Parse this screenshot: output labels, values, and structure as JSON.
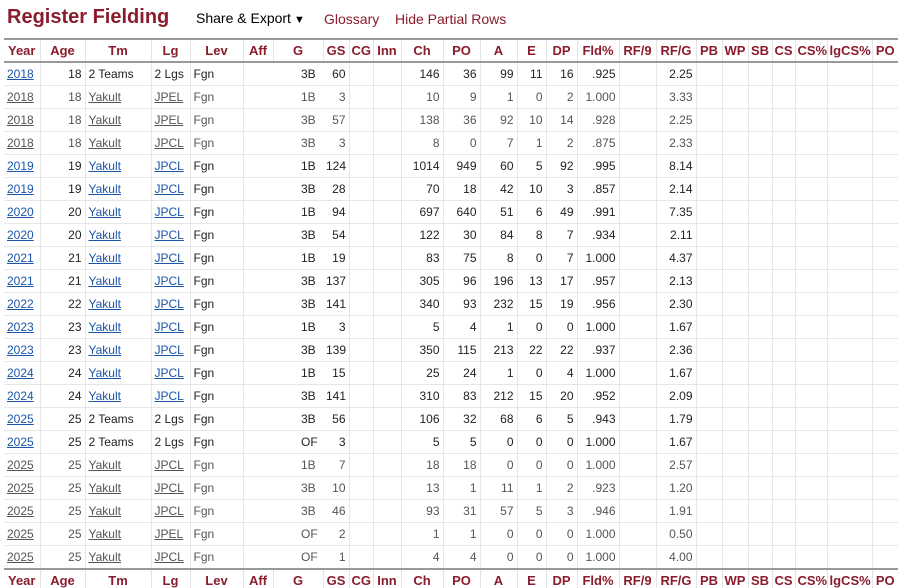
{
  "header": {
    "title": "Register Fielding",
    "share_label": "Share & Export",
    "share_caret": "▼",
    "glossary_label": "Glossary",
    "hide_partial_label": "Hide Partial Rows"
  },
  "table": {
    "columns": [
      "Year",
      "Age",
      "Tm",
      "Lg",
      "Lev",
      "Aff",
      "G",
      "GS",
      "CG",
      "Inn",
      "Ch",
      "PO",
      "A",
      "E",
      "DP",
      "Fld%",
      "RF/9",
      "RF/G",
      "PB",
      "WP",
      "SB",
      "CS",
      "CS%",
      "lgCS%",
      "PO"
    ],
    "rows": [
      {
        "partial": false,
        "cells": [
          "2018",
          "18",
          "2 Teams",
          "2 Lgs",
          "Fgn",
          "",
          "3B",
          "60",
          "",
          "",
          "146",
          "36",
          "99",
          "11",
          "16",
          ".925",
          "",
          "2.25",
          "",
          "",
          "",
          "",
          "",
          "",
          ""
        ]
      },
      {
        "partial": true,
        "cells": [
          "2018",
          "18",
          "Yakult",
          "JPEL",
          "Fgn",
          "",
          "1B",
          "3",
          "",
          "",
          "10",
          "9",
          "1",
          "0",
          "2",
          "1.000",
          "",
          "3.33",
          "",
          "",
          "",
          "",
          "",
          "",
          ""
        ]
      },
      {
        "partial": true,
        "cells": [
          "2018",
          "18",
          "Yakult",
          "JPEL",
          "Fgn",
          "",
          "3B",
          "57",
          "",
          "",
          "138",
          "36",
          "92",
          "10",
          "14",
          ".928",
          "",
          "2.25",
          "",
          "",
          "",
          "",
          "",
          "",
          ""
        ]
      },
      {
        "partial": true,
        "cells": [
          "2018",
          "18",
          "Yakult",
          "JPCL",
          "Fgn",
          "",
          "3B",
          "3",
          "",
          "",
          "8",
          "0",
          "7",
          "1",
          "2",
          ".875",
          "",
          "2.33",
          "",
          "",
          "",
          "",
          "",
          "",
          ""
        ]
      },
      {
        "partial": false,
        "cells": [
          "2019",
          "19",
          "Yakult",
          "JPCL",
          "Fgn",
          "",
          "1B",
          "124",
          "",
          "",
          "1014",
          "949",
          "60",
          "5",
          "92",
          ".995",
          "",
          "8.14",
          "",
          "",
          "",
          "",
          "",
          "",
          ""
        ]
      },
      {
        "partial": false,
        "cells": [
          "2019",
          "19",
          "Yakult",
          "JPCL",
          "Fgn",
          "",
          "3B",
          "28",
          "",
          "",
          "70",
          "18",
          "42",
          "10",
          "3",
          ".857",
          "",
          "2.14",
          "",
          "",
          "",
          "",
          "",
          "",
          ""
        ]
      },
      {
        "partial": false,
        "cells": [
          "2020",
          "20",
          "Yakult",
          "JPCL",
          "Fgn",
          "",
          "1B",
          "94",
          "",
          "",
          "697",
          "640",
          "51",
          "6",
          "49",
          ".991",
          "",
          "7.35",
          "",
          "",
          "",
          "",
          "",
          "",
          ""
        ]
      },
      {
        "partial": false,
        "cells": [
          "2020",
          "20",
          "Yakult",
          "JPCL",
          "Fgn",
          "",
          "3B",
          "54",
          "",
          "",
          "122",
          "30",
          "84",
          "8",
          "7",
          ".934",
          "",
          "2.11",
          "",
          "",
          "",
          "",
          "",
          "",
          ""
        ]
      },
      {
        "partial": false,
        "cells": [
          "2021",
          "21",
          "Yakult",
          "JPCL",
          "Fgn",
          "",
          "1B",
          "19",
          "",
          "",
          "83",
          "75",
          "8",
          "0",
          "7",
          "1.000",
          "",
          "4.37",
          "",
          "",
          "",
          "",
          "",
          "",
          ""
        ]
      },
      {
        "partial": false,
        "cells": [
          "2021",
          "21",
          "Yakult",
          "JPCL",
          "Fgn",
          "",
          "3B",
          "137",
          "",
          "",
          "305",
          "96",
          "196",
          "13",
          "17",
          ".957",
          "",
          "2.13",
          "",
          "",
          "",
          "",
          "",
          "",
          ""
        ]
      },
      {
        "partial": false,
        "cells": [
          "2022",
          "22",
          "Yakult",
          "JPCL",
          "Fgn",
          "",
          "3B",
          "141",
          "",
          "",
          "340",
          "93",
          "232",
          "15",
          "19",
          ".956",
          "",
          "2.30",
          "",
          "",
          "",
          "",
          "",
          "",
          ""
        ]
      },
      {
        "partial": false,
        "cells": [
          "2023",
          "23",
          "Yakult",
          "JPCL",
          "Fgn",
          "",
          "1B",
          "3",
          "",
          "",
          "5",
          "4",
          "1",
          "0",
          "0",
          "1.000",
          "",
          "1.67",
          "",
          "",
          "",
          "",
          "",
          "",
          ""
        ]
      },
      {
        "partial": false,
        "cells": [
          "2023",
          "23",
          "Yakult",
          "JPCL",
          "Fgn",
          "",
          "3B",
          "139",
          "",
          "",
          "350",
          "115",
          "213",
          "22",
          "22",
          ".937",
          "",
          "2.36",
          "",
          "",
          "",
          "",
          "",
          "",
          ""
        ]
      },
      {
        "partial": false,
        "cells": [
          "2024",
          "24",
          "Yakult",
          "JPCL",
          "Fgn",
          "",
          "1B",
          "15",
          "",
          "",
          "25",
          "24",
          "1",
          "0",
          "4",
          "1.000",
          "",
          "1.67",
          "",
          "",
          "",
          "",
          "",
          "",
          ""
        ]
      },
      {
        "partial": false,
        "cells": [
          "2024",
          "24",
          "Yakult",
          "JPCL",
          "Fgn",
          "",
          "3B",
          "141",
          "",
          "",
          "310",
          "83",
          "212",
          "15",
          "20",
          ".952",
          "",
          "2.09",
          "",
          "",
          "",
          "",
          "",
          "",
          ""
        ]
      },
      {
        "partial": false,
        "cells": [
          "2025",
          "25",
          "2 Teams",
          "2 Lgs",
          "Fgn",
          "",
          "3B",
          "56",
          "",
          "",
          "106",
          "32",
          "68",
          "6",
          "5",
          ".943",
          "",
          "1.79",
          "",
          "",
          "",
          "",
          "",
          "",
          ""
        ]
      },
      {
        "partial": false,
        "cells": [
          "2025",
          "25",
          "2 Teams",
          "2 Lgs",
          "Fgn",
          "",
          "OF",
          "3",
          "",
          "",
          "5",
          "5",
          "0",
          "0",
          "0",
          "1.000",
          "",
          "1.67",
          "",
          "",
          "",
          "",
          "",
          "",
          ""
        ]
      },
      {
        "partial": true,
        "cells": [
          "2025",
          "25",
          "Yakult",
          "JPCL",
          "Fgn",
          "",
          "1B",
          "7",
          "",
          "",
          "18",
          "18",
          "0",
          "0",
          "0",
          "1.000",
          "",
          "2.57",
          "",
          "",
          "",
          "",
          "",
          "",
          ""
        ]
      },
      {
        "partial": true,
        "cells": [
          "2025",
          "25",
          "Yakult",
          "JPCL",
          "Fgn",
          "",
          "3B",
          "10",
          "",
          "",
          "13",
          "1",
          "11",
          "1",
          "2",
          ".923",
          "",
          "1.20",
          "",
          "",
          "",
          "",
          "",
          "",
          ""
        ]
      },
      {
        "partial": true,
        "cells": [
          "2025",
          "25",
          "Yakult",
          "JPCL",
          "Fgn",
          "",
          "3B",
          "46",
          "",
          "",
          "93",
          "31",
          "57",
          "5",
          "3",
          ".946",
          "",
          "1.91",
          "",
          "",
          "",
          "",
          "",
          "",
          ""
        ]
      },
      {
        "partial": true,
        "cells": [
          "2025",
          "25",
          "Yakult",
          "JPEL",
          "Fgn",
          "",
          "OF",
          "2",
          "",
          "",
          "1",
          "1",
          "0",
          "0",
          "0",
          "1.000",
          "",
          "0.50",
          "",
          "",
          "",
          "",
          "",
          "",
          ""
        ]
      },
      {
        "partial": true,
        "cells": [
          "2025",
          "25",
          "Yakult",
          "JPCL",
          "Fgn",
          "",
          "OF",
          "1",
          "",
          "",
          "4",
          "4",
          "0",
          "0",
          "0",
          "1.000",
          "",
          "4.00",
          "",
          "",
          "",
          "",
          "",
          "",
          ""
        ]
      }
    ]
  },
  "colors": {
    "title": "#8a1c2c",
    "link": "#1a55a8",
    "header_text": "#8a1c2c"
  }
}
